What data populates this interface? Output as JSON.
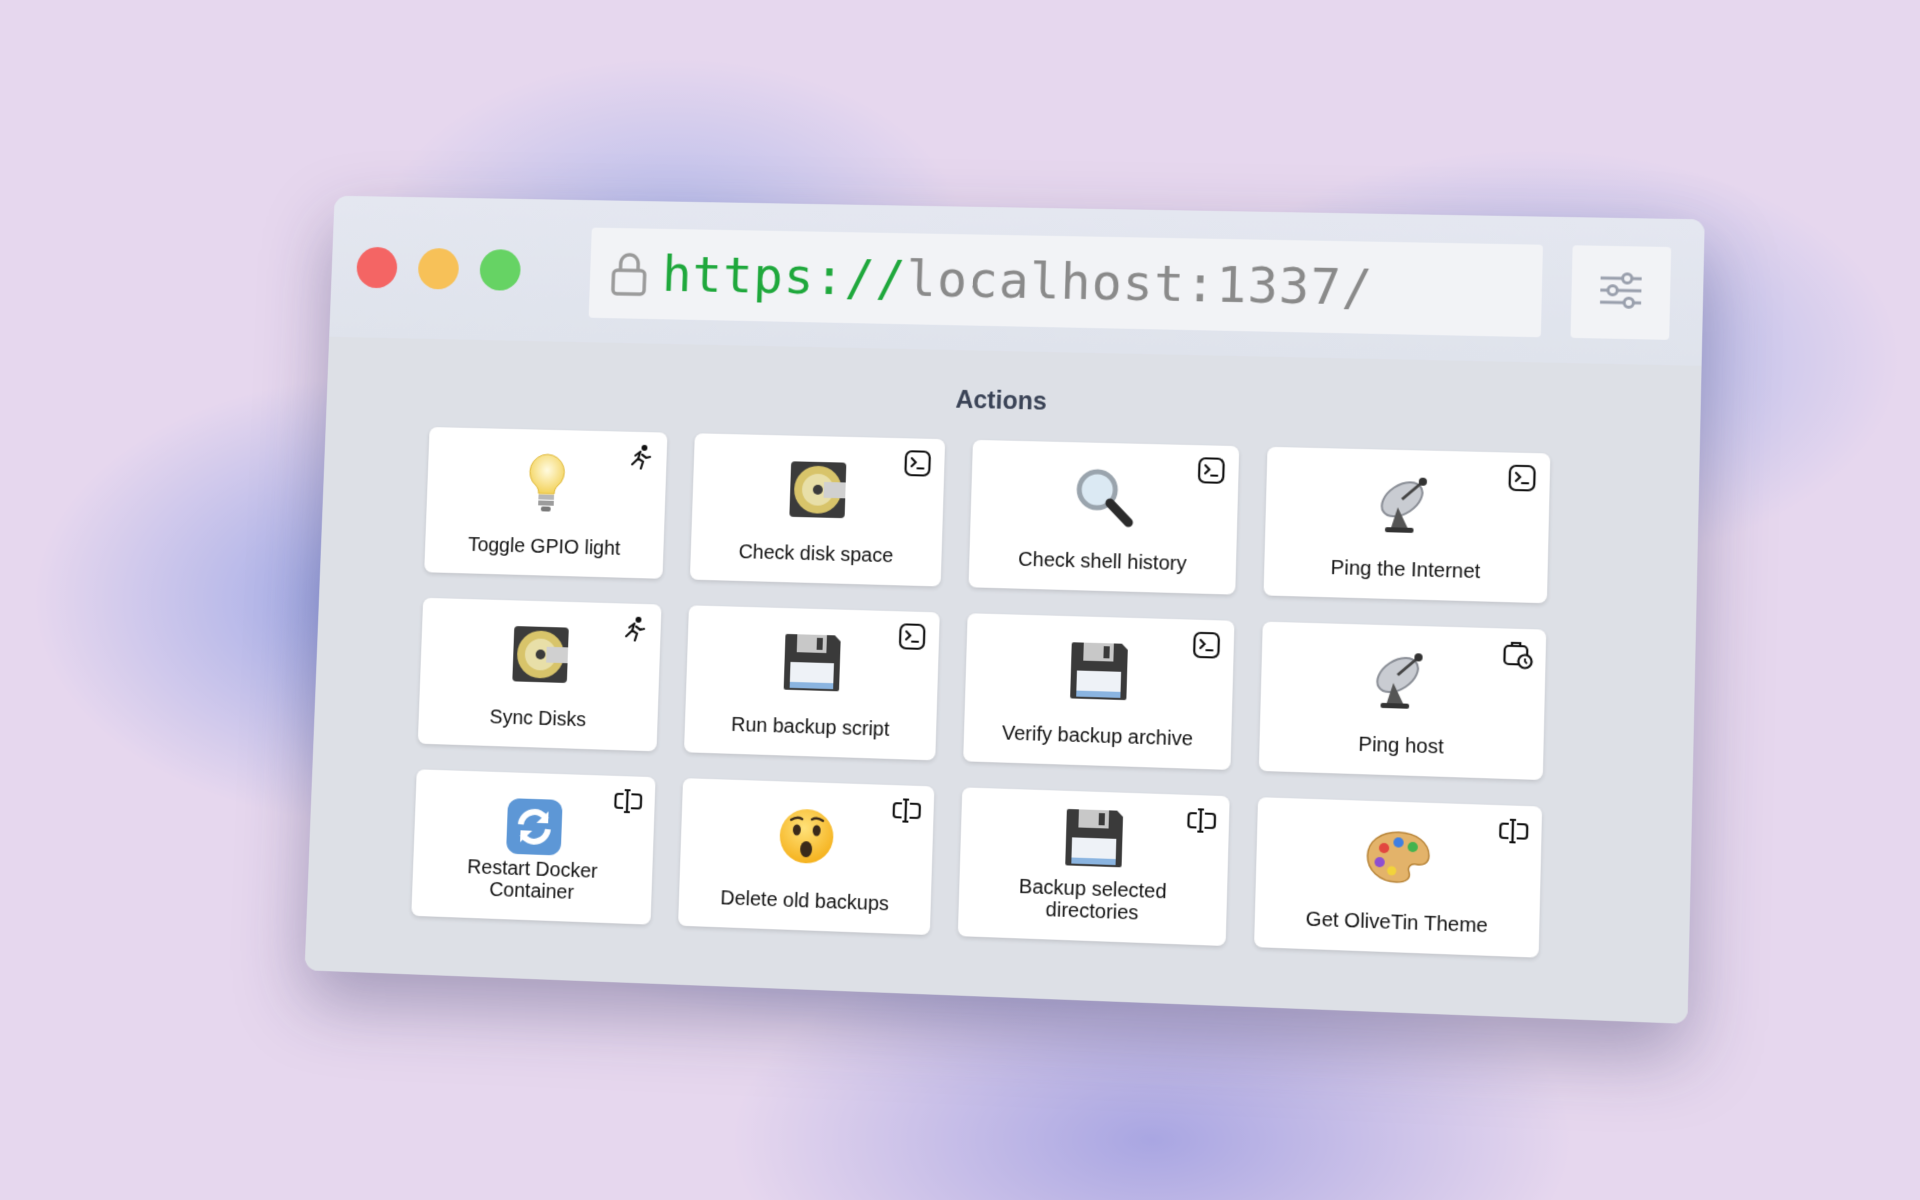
{
  "browser": {
    "url_scheme": "https://",
    "url_host": "localhost:1337/"
  },
  "content": {
    "title": "Actions"
  },
  "actions": [
    {
      "label": "Toggle GPIO light",
      "icon": "lightbulb-icon",
      "badge": "running-icon"
    },
    {
      "label": "Check disk space",
      "icon": "disc-icon",
      "badge": "terminal-icon"
    },
    {
      "label": "Check shell history",
      "icon": "magnifier-icon",
      "badge": "terminal-icon"
    },
    {
      "label": "Ping the Internet",
      "icon": "satellite-dish-icon",
      "badge": "terminal-icon"
    },
    {
      "label": "Sync Disks",
      "icon": "disc-icon",
      "badge": "running-icon"
    },
    {
      "label": "Run backup script",
      "icon": "floppy-disk-icon",
      "badge": "terminal-icon"
    },
    {
      "label": "Verify backup archive",
      "icon": "floppy-disk-icon",
      "badge": "terminal-icon"
    },
    {
      "label": "Ping host",
      "icon": "satellite-dish-icon",
      "badge": "timer-briefcase-icon"
    },
    {
      "label": "Restart Docker Container",
      "icon": "refresh-arrows-icon",
      "badge": "input-arguments-icon"
    },
    {
      "label": "Delete old backups",
      "icon": "astonished-face-icon",
      "badge": "input-arguments-icon"
    },
    {
      "label": "Backup selected directories",
      "icon": "floppy-disk-icon",
      "badge": "input-arguments-icon"
    },
    {
      "label": "Get OliveTin Theme",
      "icon": "palette-icon",
      "badge": "input-arguments-icon"
    }
  ],
  "colors": {
    "traffic_red": "#f46564",
    "traffic_yellow": "#f7c158",
    "traffic_green": "#66d364",
    "url_scheme": "#1fa83c",
    "url_host": "#8a8a8a",
    "content_bg": "#dde0e6",
    "title_text": "#3a4356"
  }
}
